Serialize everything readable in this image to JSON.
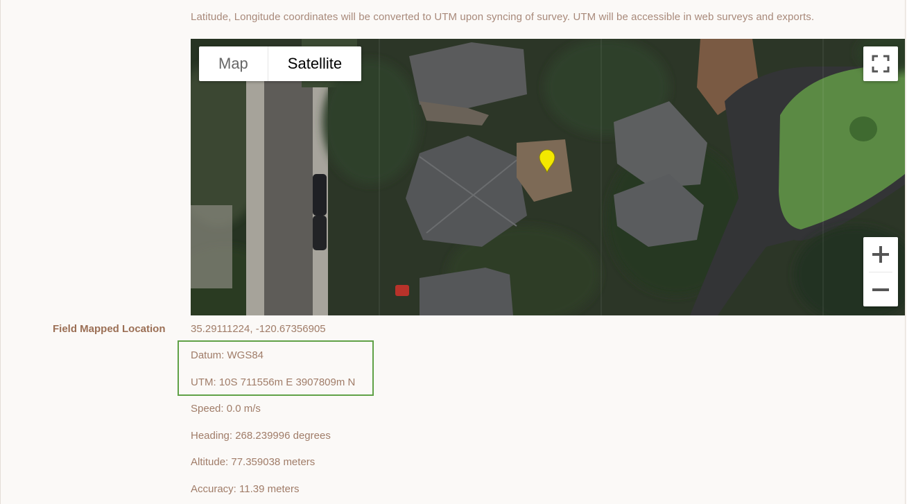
{
  "info_text": "Latitude, Longitude coordinates will be converted to UTM upon syncing of survey. UTM will be accessible in web surveys and exports.",
  "map": {
    "type_buttons": [
      "Map",
      "Satellite"
    ],
    "active_type": "Satellite",
    "controls": [
      "fullscreen-icon",
      "zoom-in-icon",
      "zoom-out-icon"
    ],
    "marker_icon": "map-pin-icon",
    "marker_color": "#f3e800"
  },
  "field_label": "Field Mapped Location",
  "details": {
    "coordinates": "35.29111224, -120.67356905",
    "datum": "Datum: WGS84",
    "utm": "UTM: 10S 711556m E 3907809m N",
    "speed": "Speed: 0.0 m/s",
    "heading": "Heading: 268.239996 degrees",
    "altitude": "Altitude: 77.359038 meters",
    "accuracy": "Accuracy: 11.39 meters"
  },
  "highlight_color": "#5fa146"
}
